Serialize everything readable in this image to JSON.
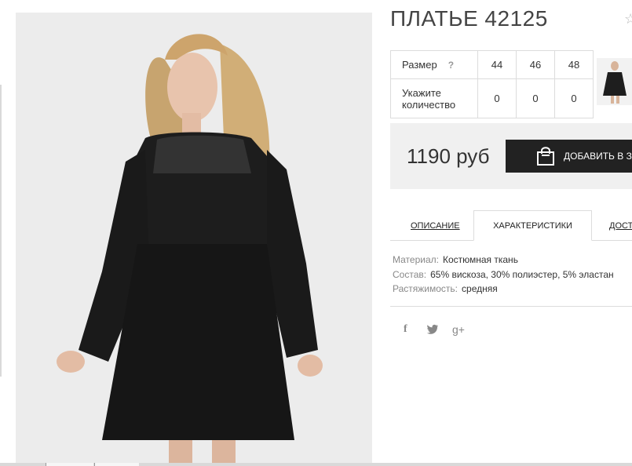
{
  "product": {
    "title": "ПЛАТЬЕ 42125",
    "image_alt": "dress-photo"
  },
  "sizes": {
    "size_label": "Размер",
    "help_label": "?",
    "values": [
      "44",
      "46",
      "48"
    ],
    "qty_label": "Укажите количество",
    "qty_values": [
      "0",
      "0",
      "0"
    ]
  },
  "purchase": {
    "price": "1190 руб",
    "cart_label": "ДОБАВИТЬ В ЗА"
  },
  "tabs": {
    "description": "ОПИСАНИЕ",
    "characteristics": "ХАРАКТЕРИСТИКИ",
    "delivery": "ДОСТ"
  },
  "specs": [
    {
      "key": "Материал:",
      "value": "Костюмная ткань"
    },
    {
      "key": "Состав:",
      "value": "65% вискоза, 30% полиэстер, 5% эластан"
    },
    {
      "key": "Растяжимость:",
      "value": "средняя"
    }
  ],
  "social": {
    "facebook": "f",
    "googleplus": "g+"
  },
  "colors": {
    "dark_button": "#222222",
    "price_panel": "#f0f0f0",
    "border": "#dcdcdc"
  },
  "icons": [
    "star-icon",
    "shopping-bag-icon",
    "facebook-icon",
    "twitter-icon",
    "google-plus-icon"
  ]
}
